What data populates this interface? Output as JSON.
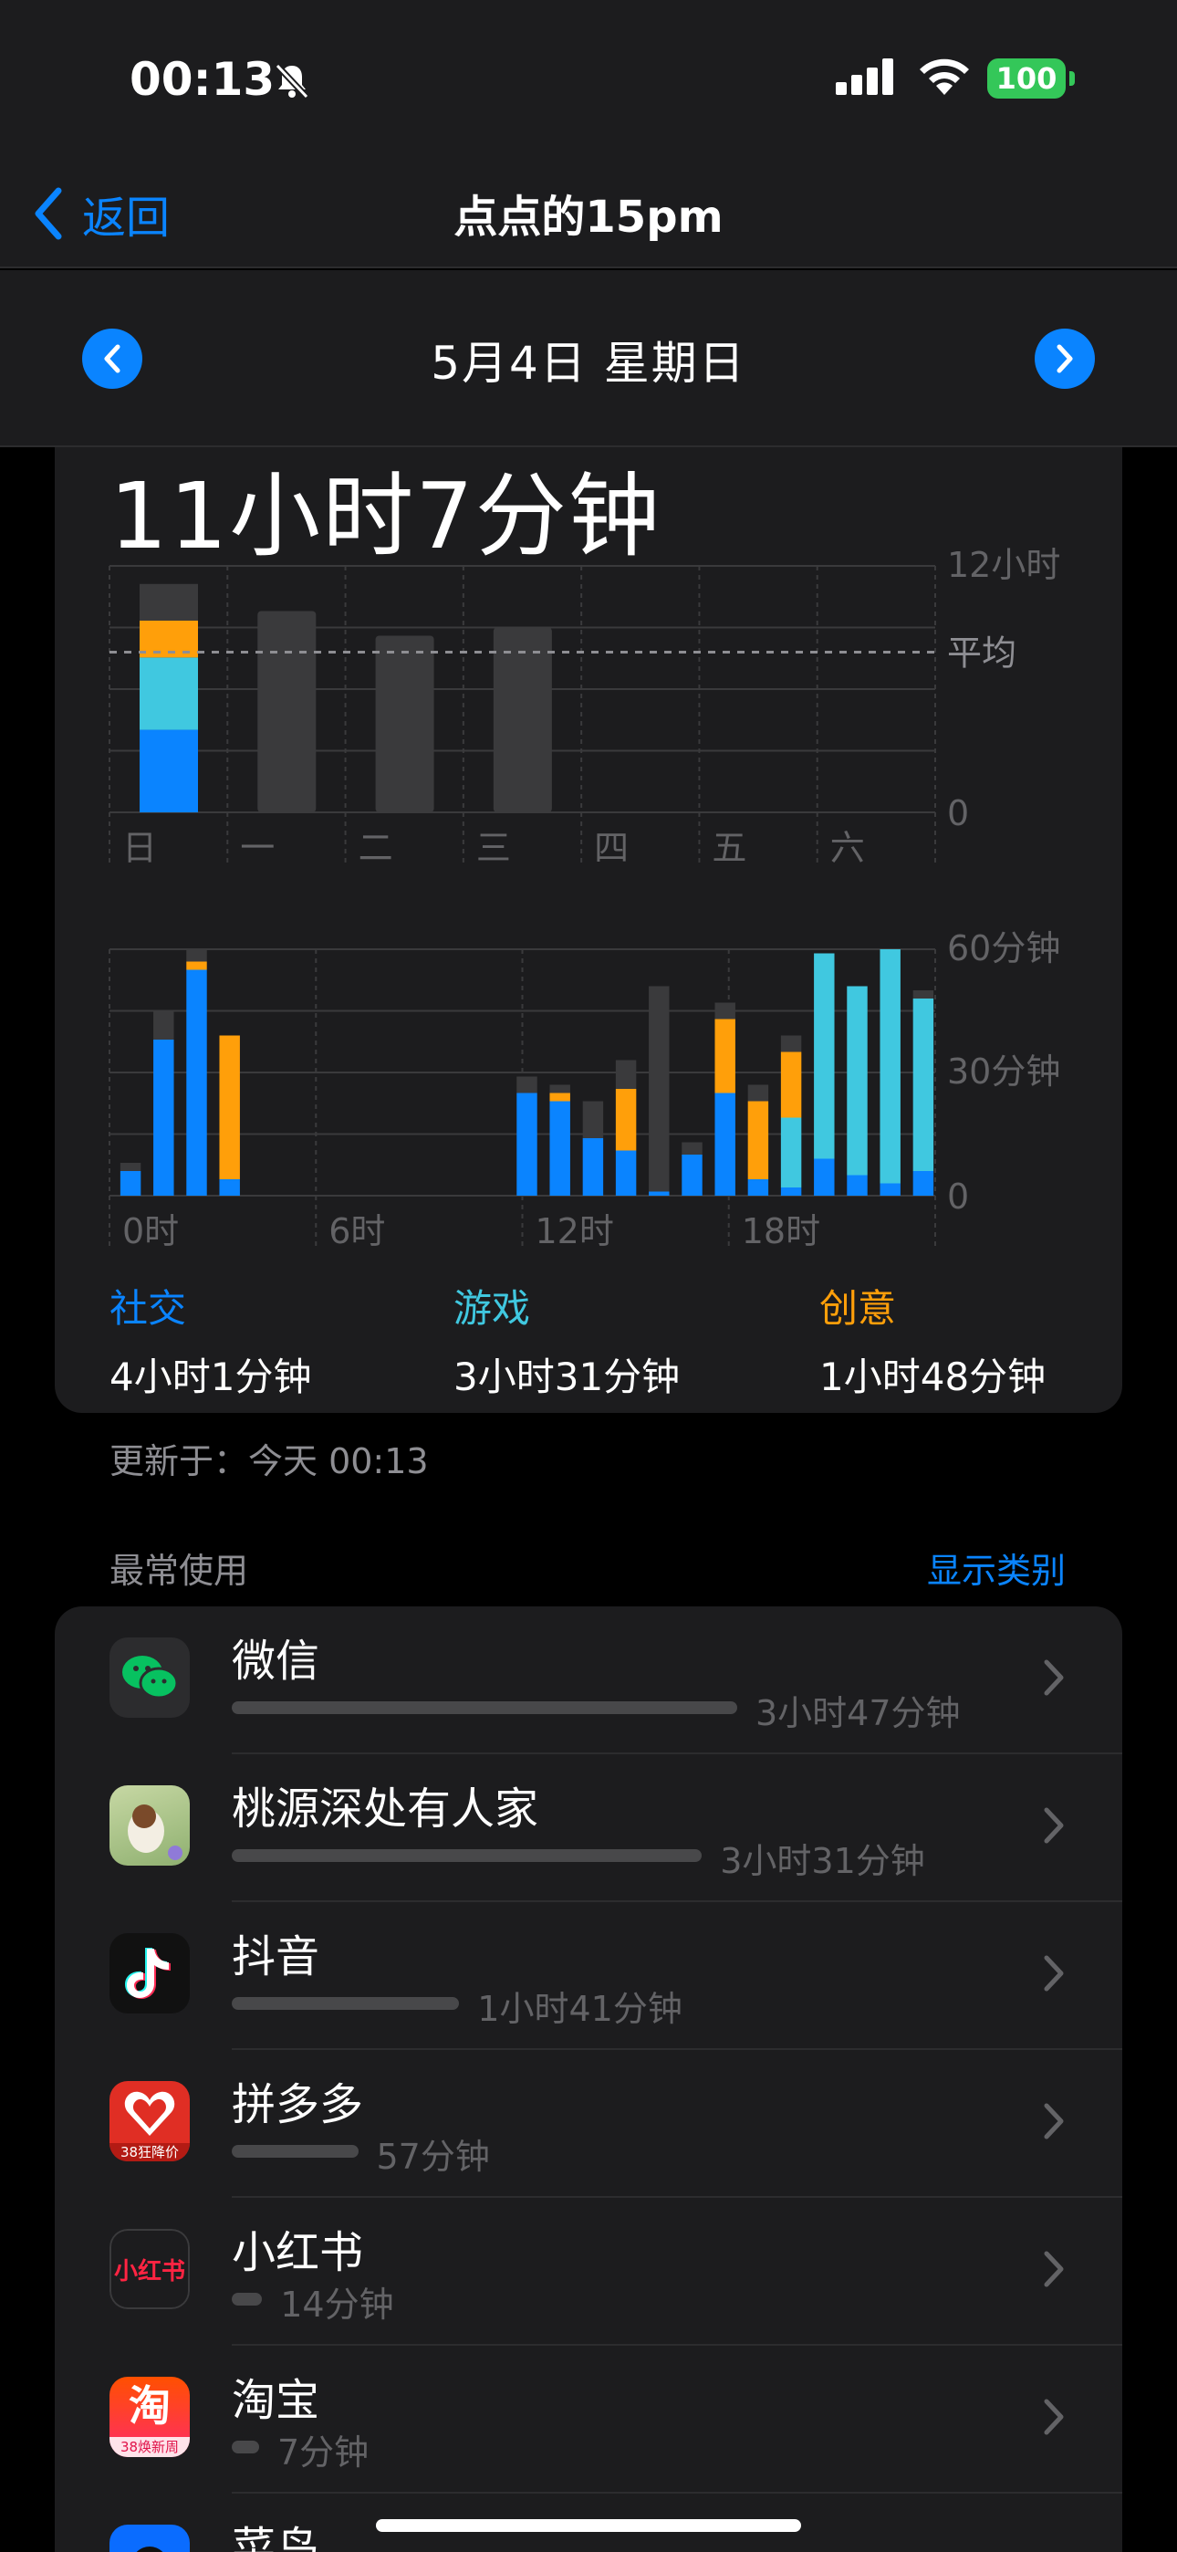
{
  "status": {
    "time": "00:13",
    "battery": "100"
  },
  "nav": {
    "back_label": "返回",
    "title": "点点的15pm"
  },
  "date": {
    "label": "5月4日 星期日"
  },
  "summary": {
    "total": "11小时7分钟"
  },
  "week_chart": {
    "y_top_label": "12小时",
    "avg_label": "平均",
    "y_zero_label": "0",
    "days": [
      "日",
      "一",
      "二",
      "三",
      "四",
      "五",
      "六"
    ],
    "max_hours": 12,
    "avg_hours": 7.8,
    "bars": [
      {
        "total": 11.1,
        "social": 4.02,
        "games": 3.52,
        "creativity": 1.8,
        "other": 1.78
      },
      {
        "total": 9.8
      },
      {
        "total": 8.6
      },
      {
        "total": 9.0
      },
      {
        "total": 0
      },
      {
        "total": 0
      },
      {
        "total": 0
      }
    ]
  },
  "day_chart": {
    "y_labels": [
      "60分钟",
      "30分钟",
      "0"
    ],
    "x_labels": [
      "0时",
      "6时",
      "12时",
      "18时"
    ],
    "max_minutes": 60,
    "hours": [
      {
        "social": 6,
        "games": 0,
        "creativity": 0,
        "other": 2
      },
      {
        "social": 38,
        "games": 0,
        "creativity": 0,
        "other": 7
      },
      {
        "social": 55,
        "games": 0,
        "creativity": 2,
        "other": 3
      },
      {
        "social": 4,
        "games": 0,
        "creativity": 35,
        "other": 0
      },
      {
        "social": 0,
        "games": 0,
        "creativity": 0,
        "other": 0
      },
      {
        "social": 0,
        "games": 0,
        "creativity": 0,
        "other": 0
      },
      {
        "social": 0,
        "games": 0,
        "creativity": 0,
        "other": 0
      },
      {
        "social": 0,
        "games": 0,
        "creativity": 0,
        "other": 0
      },
      {
        "social": 0,
        "games": 0,
        "creativity": 0,
        "other": 0
      },
      {
        "social": 0,
        "games": 0,
        "creativity": 0,
        "other": 0
      },
      {
        "social": 0,
        "games": 0,
        "creativity": 0,
        "other": 0
      },
      {
        "social": 0,
        "games": 0,
        "creativity": 0,
        "other": 0
      },
      {
        "social": 25,
        "games": 0,
        "creativity": 0,
        "other": 4
      },
      {
        "social": 23,
        "games": 0,
        "creativity": 2,
        "other": 2
      },
      {
        "social": 14,
        "games": 0,
        "creativity": 0,
        "other": 9
      },
      {
        "social": 11,
        "games": 0,
        "creativity": 15,
        "other": 7
      },
      {
        "social": 1,
        "games": 0,
        "creativity": 0,
        "other": 50
      },
      {
        "social": 10,
        "games": 0,
        "creativity": 0,
        "other": 3
      },
      {
        "social": 25,
        "games": 0,
        "creativity": 18,
        "other": 4
      },
      {
        "social": 4,
        "games": 0,
        "creativity": 19,
        "other": 4
      },
      {
        "social": 2,
        "games": 17,
        "creativity": 16,
        "other": 4
      },
      {
        "social": 9,
        "games": 50,
        "creativity": 0,
        "other": 0
      },
      {
        "social": 5,
        "games": 46,
        "creativity": 0,
        "other": 0
      },
      {
        "social": 3,
        "games": 57,
        "creativity": 0,
        "other": 0
      },
      {
        "social": 6,
        "games": 42,
        "creativity": 0,
        "other": 2
      }
    ]
  },
  "categories": [
    {
      "name": "社交",
      "value": "4小时1分钟",
      "color": "#0a84ff"
    },
    {
      "name": "游戏",
      "value": "3小时31分钟",
      "color": "#5ac8fa"
    },
    {
      "name": "创意",
      "value": "1小时48分钟",
      "color": "#ff9f0a"
    }
  ],
  "colors": {
    "social": "#0a84ff",
    "games": "#40c8e0",
    "creativity": "#ff9f0a",
    "other": "#3a3a3c",
    "grid": "#3a3a3c",
    "label": "#636366"
  },
  "updated": "更新于：今天 00:13",
  "most_used": {
    "title": "最常使用",
    "link": "显示类别"
  },
  "apps": [
    {
      "name": "微信",
      "time": "3小时47分钟",
      "fraction": 1.0,
      "icon": "wechat-icon"
    },
    {
      "name": "桃源深处有人家",
      "time": "3小时31分钟",
      "fraction": 0.93,
      "icon": "taoyuan-game-icon"
    },
    {
      "name": "抖音",
      "time": "1小时41分钟",
      "fraction": 0.45,
      "icon": "douyin-icon"
    },
    {
      "name": "拼多多",
      "time": "57分钟",
      "fraction": 0.25,
      "icon": "pinduoduo-icon",
      "badge": "38狂降价"
    },
    {
      "name": "小红书",
      "time": "14分钟",
      "fraction": 0.06,
      "icon": "xiaohongshu-icon",
      "logo": "小红书"
    },
    {
      "name": "淘宝",
      "time": "7分钟",
      "fraction": 0.03,
      "icon": "taobao-icon",
      "logo": "淘",
      "badge": "38焕新周"
    },
    {
      "name": "菜鸟",
      "time": "",
      "fraction": 0.0,
      "icon": "cainiao-icon"
    }
  ]
}
